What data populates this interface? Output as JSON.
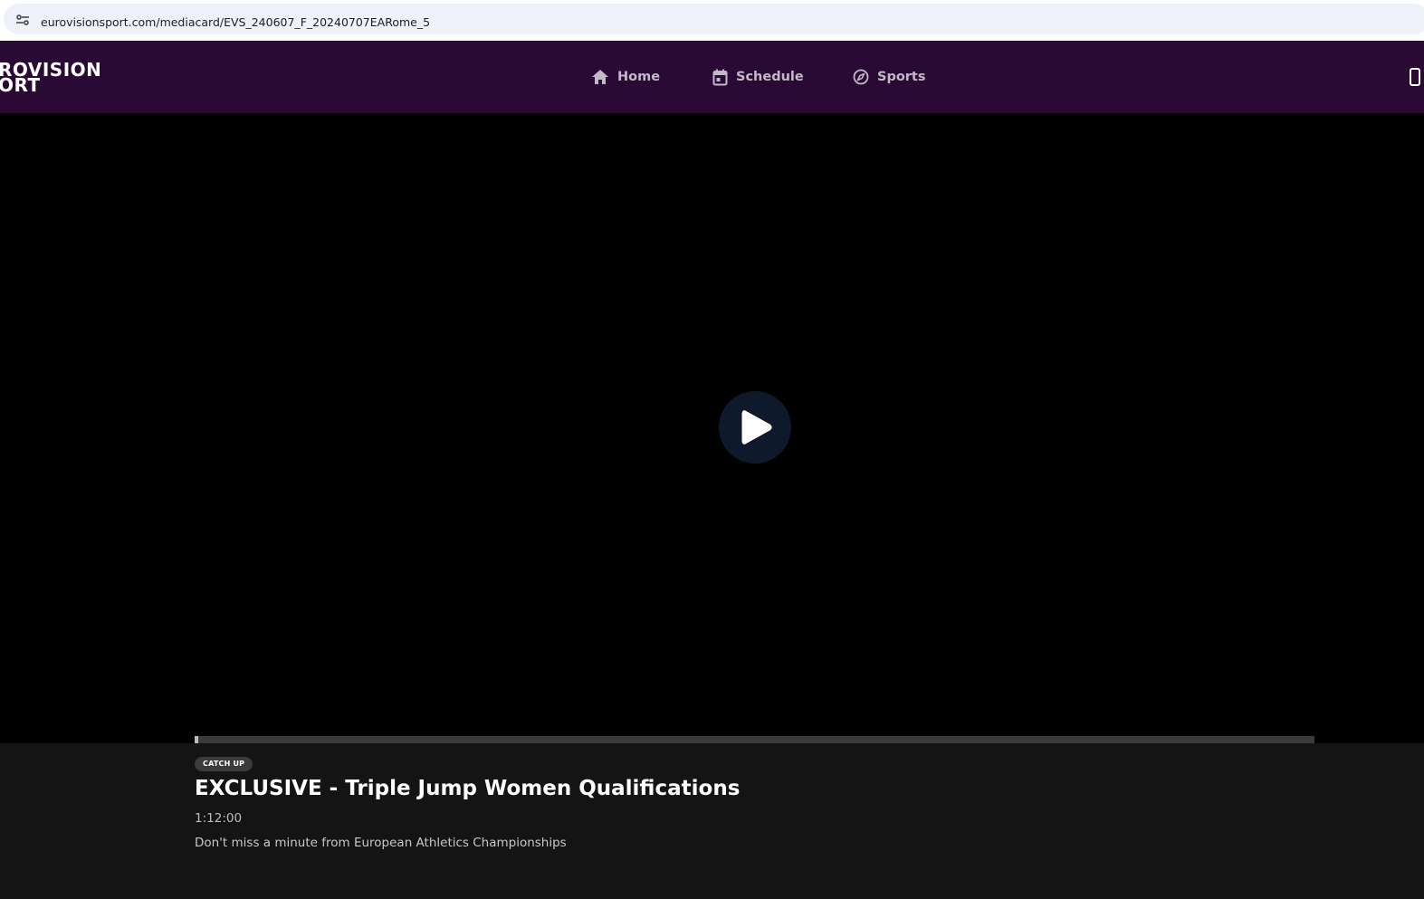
{
  "browser": {
    "url": "eurovisionsport.com/mediacard/EVS_240607_F_20240707EARome_5",
    "site_info_icon": "tune-icon"
  },
  "header": {
    "logo_line1": "ROVISION",
    "logo_line2": "ORT",
    "nav": [
      {
        "label": "Home",
        "icon": "home-icon"
      },
      {
        "label": "Schedule",
        "icon": "calendar-icon"
      },
      {
        "label": "Sports",
        "icon": "compass-icon"
      }
    ],
    "right_icon": "device-icon",
    "colors": {
      "background": "#2a0a35",
      "nav_text": "#c2b9c7"
    }
  },
  "player": {
    "play_icon": "play-icon",
    "progress": 0.003
  },
  "media": {
    "badge": "CATCH UP",
    "title": "EXCLUSIVE - Triple Jump Women Qualifications",
    "duration": "1:12:00",
    "description": "Don't miss a minute from European Athletics Championships"
  }
}
